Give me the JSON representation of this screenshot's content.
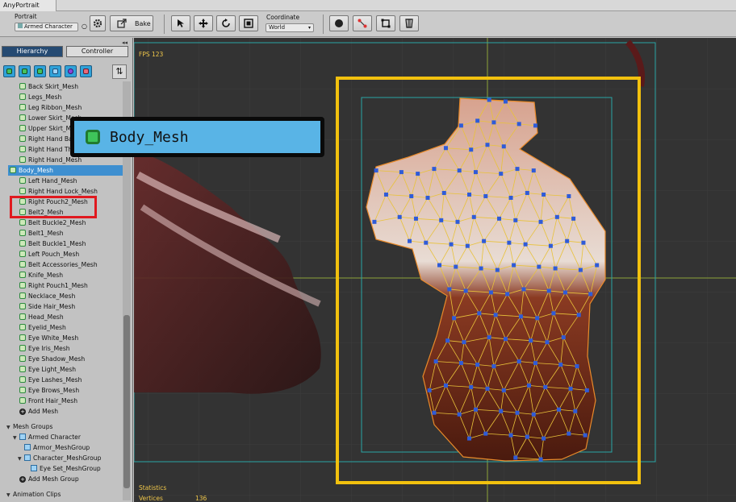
{
  "app": {
    "title": "AnyPortrait"
  },
  "toolbar": {
    "portrait_label": "Portrait",
    "portrait_value": "Armed Character",
    "bake_label": "Bake",
    "coordinate_label": "Coordinate",
    "coordinate_value": "World"
  },
  "panel": {
    "tabs": {
      "hierarchy": "Hierarchy",
      "controller": "Controller"
    },
    "collapse": "◂◂"
  },
  "tree": {
    "meshes": [
      "Back Skirt_Mesh",
      "Legs_Mesh",
      "Leg Ribbon_Mesh",
      "Lower Skirt_Mesh",
      "Upper Skirt_Mesh",
      "Right Hand Back_Mesh",
      "Right Hand Thumb_Mesh",
      "Right Hand_Mesh",
      "Body_Mesh",
      "Left Hand_Mesh",
      "Right Hand Lock_Mesh",
      "Right Pouch2_Mesh",
      "Belt2_Mesh",
      "Belt Buckle2_Mesh",
      "Belt1_Mesh",
      "Belt Buckle1_Mesh",
      "Left Pouch_Mesh",
      "Belt Accessories_Mesh",
      "Knife_Mesh",
      "Right Pouch1_Mesh",
      "Necklace_Mesh",
      "Side Hair_Mesh",
      "Head_Mesh",
      "Eyelid_Mesh",
      "Eye White_Mesh",
      "Eye Iris_Mesh",
      "Eye Shadow_Mesh",
      "Eye Light_Mesh",
      "Eye Lashes_Mesh",
      "Eye Brows_Mesh",
      "Front Hair_Mesh"
    ],
    "selected_index": 8,
    "add_mesh": "Add Mesh",
    "mesh_groups_header": "Mesh Groups",
    "group_armed": "Armed Character",
    "group_armor": "Armor_MeshGroup",
    "group_character": "Character_MeshGroup",
    "group_eye": "Eye Set_MeshGroup",
    "add_mesh_group": "Add Mesh Group",
    "animation_header": "Animation Clips"
  },
  "viewport": {
    "fps": "FPS 123",
    "stats_label": "Statistics",
    "vertices_label": "Vertices",
    "vertices_value": "136"
  },
  "tooltip": {
    "text": "Body_Mesh"
  },
  "colors": {
    "selection": "#3e8fd0",
    "highlight_box": "#e0191f",
    "mesh_bounds": "#f2c10e",
    "tooltip_bg": "#59b4e6",
    "vertex": "#2f5bd8",
    "edge": "#e8c23a"
  }
}
